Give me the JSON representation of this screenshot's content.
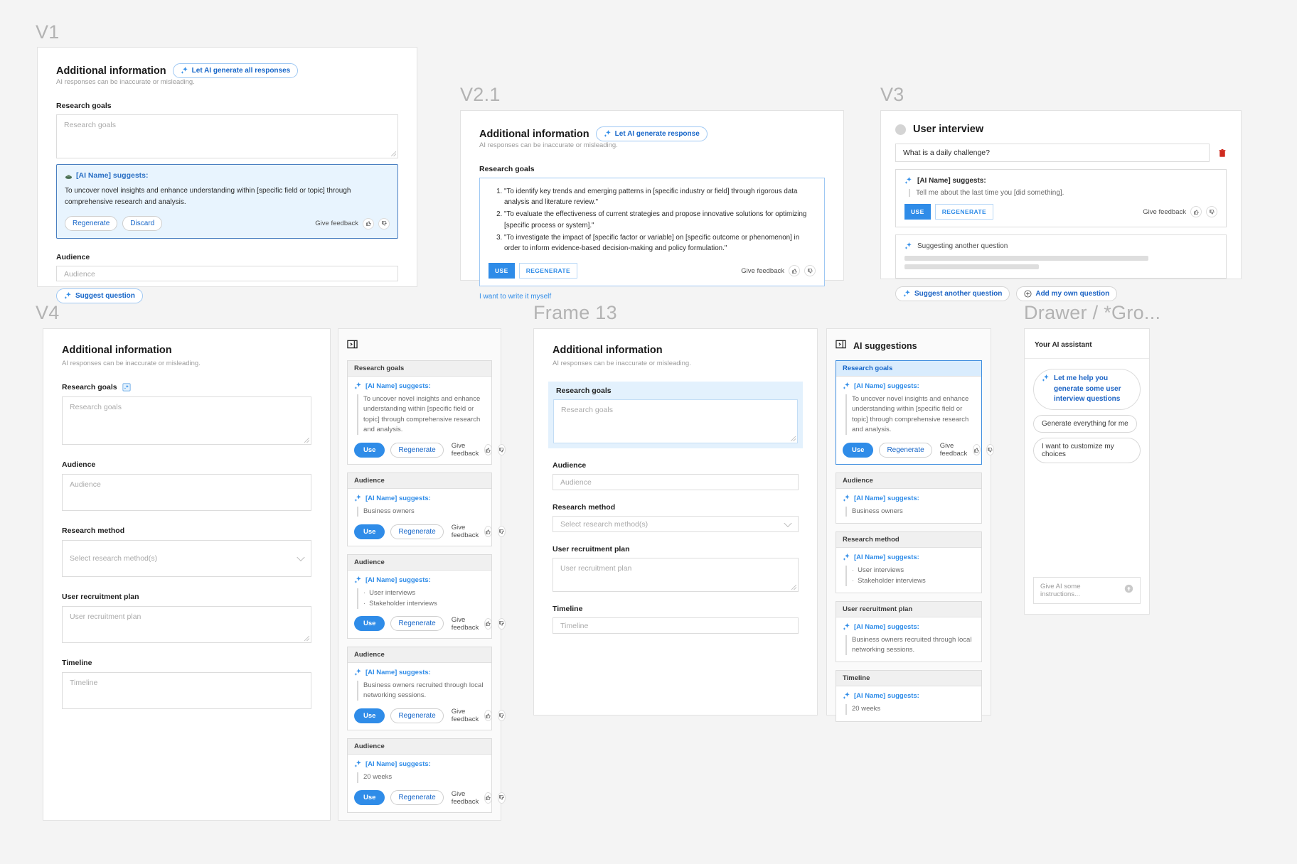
{
  "frames": {
    "v1": "V1",
    "v21": "V2.1",
    "v3": "V3",
    "v4": "V4",
    "frame13": "Frame 13",
    "drawer": "Drawer / *Gro..."
  },
  "common": {
    "section_title": "Additional information",
    "disclaimer": "AI responses can be inaccurate or misleading.",
    "suggests_by": "[AI Name] suggests:",
    "give_feedback": "Give feedback",
    "use": "Use",
    "use_caps": "USE",
    "regenerate": "Regenerate",
    "regenerate_caps": "REGENERATE",
    "discard": "Discard",
    "thumbs_up_icon": "thumbs-up-icon",
    "thumbs_down_icon": "thumbs-down-icon",
    "sparkle_icon": "sparkle-icon"
  },
  "fields": {
    "research_goals": {
      "label": "Research goals",
      "placeholder": "Research goals"
    },
    "audience": {
      "label": "Audience",
      "placeholder": "Audience"
    },
    "research_method": {
      "label": "Research method",
      "placeholder": "Select research method(s)"
    },
    "user_recruitment_plan": {
      "label": "User recruitment plan",
      "placeholder": "User recruitment plan"
    },
    "timeline": {
      "label": "Timeline",
      "placeholder": "Timeline"
    }
  },
  "suggestions": {
    "research_goals_text": "To uncover novel insights and enhance understanding within [specific field or topic] through comprehensive research and analysis.",
    "audience_text": "Business owners",
    "method_items": [
      "User interviews",
      "Stakeholder interviews"
    ],
    "recruitment_text": "Business owners recruited through local networking sessions.",
    "timeline_text": "20 weeks"
  },
  "v1": {
    "generate_all_label": "Let AI generate all responses",
    "suggest_question_label": "Suggest question"
  },
  "v21": {
    "generate_label": "Let AI generate response",
    "goals_list": [
      "\"To identify key trends and emerging patterns in [specific industry or field] through rigorous data analysis and literature review.\"",
      "\"To evaluate the effectiveness of current strategies and propose innovative solutions for optimizing [specific process or system].\"",
      "\"To investigate the impact of [specific factor or variable] on [specific outcome or phenomenon] in order to inform evidence-based decision-making and policy formulation.\""
    ],
    "write_myself_link": "I want to write it myself"
  },
  "v3": {
    "title": "User interview",
    "question_value": "What is a daily challenge?",
    "delete_icon": "trash-icon",
    "suggestion_text": "Tell me about the last time you [did something].",
    "suggesting_label": "Suggesting another question",
    "suggest_another_label": "Suggest another question",
    "add_own_label": "Add my own question",
    "add_icon": "plus-circle-icon"
  },
  "v4": {
    "goals_badge_icon": "ai-badge-icon",
    "collapse_icon": "collapse-panel-icon",
    "cards": [
      {
        "header": "Research goals",
        "kind": "text",
        "text": "To uncover novel insights and enhance understanding within [specific field or topic] through comprehensive research and analysis."
      },
      {
        "header": "Audience",
        "kind": "text",
        "text": "Business owners"
      },
      {
        "header": "Audience",
        "kind": "list",
        "items": [
          "User interviews",
          "Stakeholder interviews"
        ]
      },
      {
        "header": "Audience",
        "kind": "text",
        "text": "Business owners recruited through local networking sessions."
      },
      {
        "header": "Audience",
        "kind": "text",
        "text": "20 weeks"
      }
    ]
  },
  "frame13": {
    "sidebar_title": "AI suggestions",
    "collapse_icon": "collapse-panel-icon",
    "cards": [
      {
        "header": "Research goals",
        "kind": "text",
        "selected": true,
        "text": "To uncover novel insights and enhance understanding within [specific field or topic] through comprehensive research and analysis."
      },
      {
        "header": "Audience",
        "kind": "text",
        "selected": false,
        "text": "Business owners"
      },
      {
        "header": "Research method",
        "kind": "list",
        "selected": false,
        "items": [
          "User interviews",
          "Stakeholder interviews"
        ]
      },
      {
        "header": "User recruitment plan",
        "kind": "text",
        "selected": false,
        "text": "Business owners recruited through local networking sessions."
      },
      {
        "header": "Timeline",
        "kind": "text",
        "selected": false,
        "text": "20 weeks"
      }
    ]
  },
  "drawer": {
    "title": "Your AI assistant",
    "primary_prompt": "Let me help you generate some user interview questions",
    "options": [
      "Generate everything for me",
      "I want to customize my choices"
    ],
    "input_placeholder": "Give AI some instructions...",
    "send_icon": "send-arrow-icon"
  }
}
